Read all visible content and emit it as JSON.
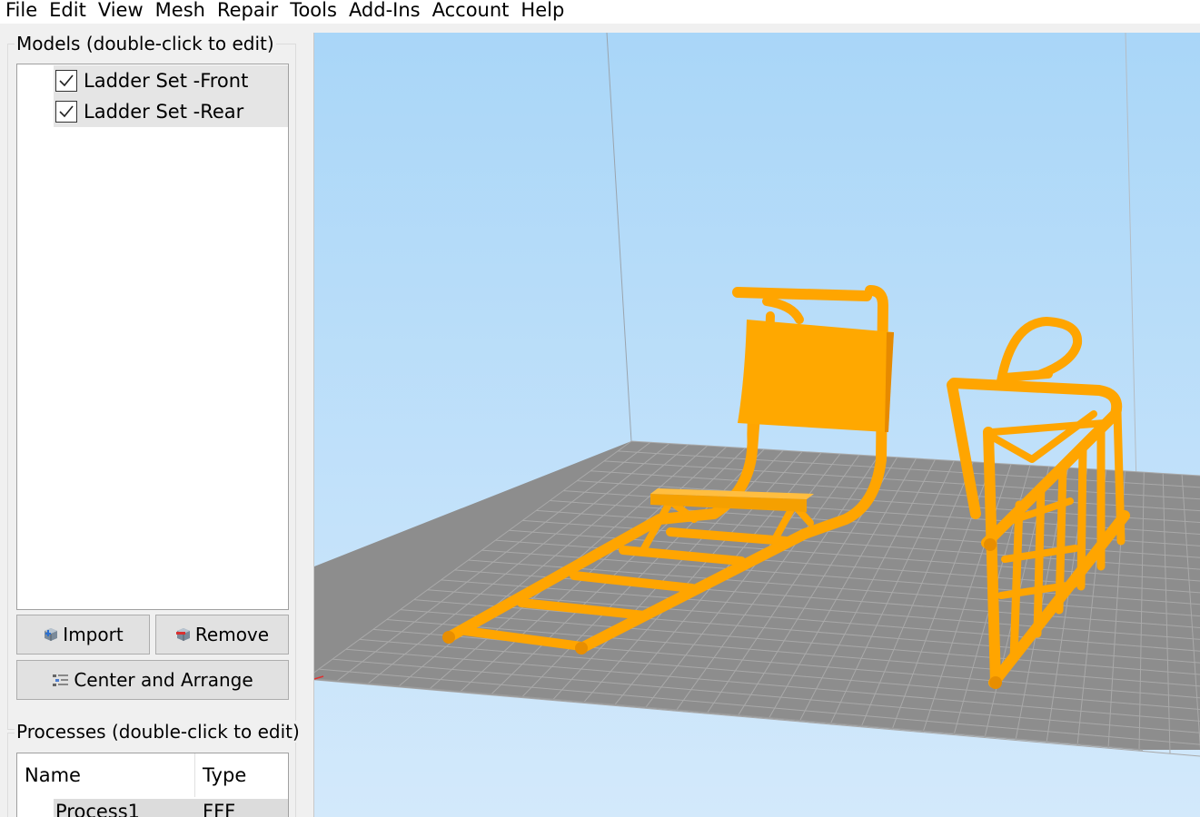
{
  "menu": [
    "File",
    "Edit",
    "View",
    "Mesh",
    "Repair",
    "Tools",
    "Add-Ins",
    "Account",
    "Help"
  ],
  "models_panel": {
    "title": "Models (double-click to edit)",
    "items": [
      {
        "label": "Ladder Set -Front",
        "checked": true
      },
      {
        "label": "Ladder Set -Rear",
        "checked": true
      }
    ],
    "import_label": "Import",
    "remove_label": "Remove",
    "center_label": "Center and Arrange"
  },
  "processes_panel": {
    "title": "Processes (double-click to edit)",
    "columns": [
      "Name",
      "Type"
    ],
    "rows": [
      {
        "name": "Process1",
        "type": "FFF"
      }
    ]
  },
  "viewport": {
    "background_top": "#acd8f8",
    "background_bottom": "#d0e8fa",
    "bed_color": "#8c8c8c",
    "grid_color": "#a8a8a8",
    "model_color": "#ffa500"
  }
}
